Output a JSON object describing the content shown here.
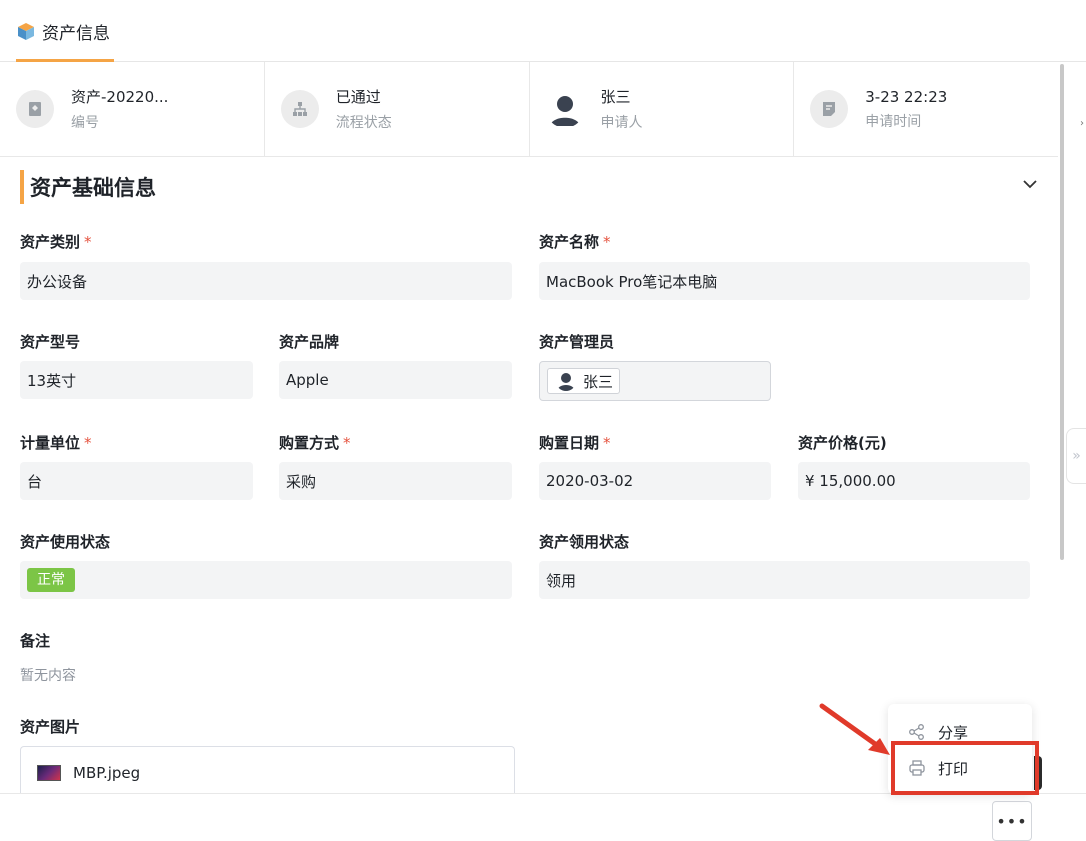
{
  "tab": {
    "title": "资产信息"
  },
  "summary": [
    {
      "value": "资产-20220...",
      "label": "编号",
      "icon": "badge-icon"
    },
    {
      "value": "已通过",
      "label": "流程状态",
      "icon": "org-chart-icon"
    },
    {
      "value": "张三",
      "label": "申请人",
      "icon": "avatar"
    },
    {
      "value": "3-23 22:23",
      "label": "申请时间",
      "icon": "calendar-note-icon"
    }
  ],
  "section": {
    "title": "资产基础信息"
  },
  "fields": {
    "category": {
      "label": "资产类别",
      "required": "*",
      "value": "办公设备"
    },
    "name": {
      "label": "资产名称",
      "required": "*",
      "value": "MacBook Pro笔记本电脑"
    },
    "model": {
      "label": "资产型号",
      "value": "13英寸"
    },
    "brand": {
      "label": "资产品牌",
      "value": "Apple"
    },
    "manager": {
      "label": "资产管理员",
      "value": "张三"
    },
    "unit": {
      "label": "计量单位",
      "required": "*",
      "value": "台"
    },
    "purchase_method": {
      "label": "购置方式",
      "required": "*",
      "value": "采购"
    },
    "purchase_date": {
      "label": "购置日期",
      "required": "*",
      "value": "2020-03-02"
    },
    "price": {
      "label": "资产价格(元)",
      "value": "¥ 15,000.00"
    },
    "use_status": {
      "label": "资产使用状态",
      "value": "正常"
    },
    "claim_status": {
      "label": "资产领用状态",
      "value": "领用"
    },
    "remark": {
      "label": "备注",
      "value": "暂无内容"
    },
    "images": {
      "label": "资产图片",
      "file": "MBP.jpeg"
    }
  },
  "menu": {
    "share": "分享",
    "print": "打印"
  },
  "more_button": "•••",
  "colors": {
    "accent": "#f5a445",
    "status_ok": "#7cc546",
    "highlight": "#e03a2a"
  }
}
